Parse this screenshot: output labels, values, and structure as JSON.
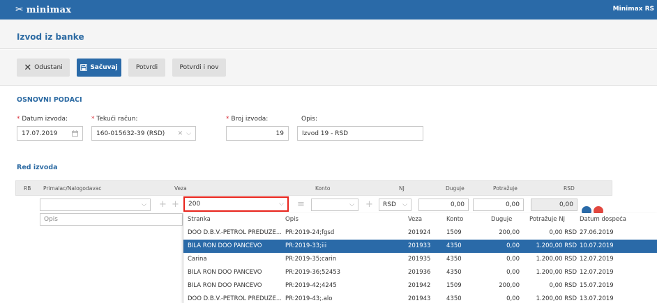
{
  "topbar": {
    "logo_text": "minimax",
    "logo_icon": "percent-scissors-icon",
    "company": "Minimax RS"
  },
  "page": {
    "title": "Izvod iz banke"
  },
  "toolbar": {
    "cancel_icon": "close-icon",
    "cancel_label": "Odustani",
    "save_icon": "floppy-disk-icon",
    "save_label": "Sačuvaj",
    "confirm_label": "Potvrdi",
    "confirm_new_label": "Potvrdi i nov"
  },
  "basic": {
    "section_title": "OSNOVNI PODACI",
    "required_mark": "*",
    "date_label": "Datum izvoda:",
    "date_value": "17.07.2019",
    "account_label": "Tekući račun:",
    "account_value": "160-015632-39 (RSD)",
    "number_label": "Broj izvoda:",
    "number_value": "19",
    "desc_label": "Opis:",
    "desc_value": "Izvod 19 - RSD"
  },
  "lines": {
    "section_title": "Red izvoda",
    "columns": {
      "rb": "RB",
      "partner": "Primalac/Nalogodavac",
      "link": "Veza",
      "account": "Konto",
      "nj": "NJ",
      "debit": "Duguje",
      "credit": "Potražuje",
      "rsd": "RSD"
    },
    "row": {
      "link_value": "200",
      "currency": "RSD",
      "debit": "0,00",
      "credit": "0,00",
      "rsd": "0,00",
      "desc_placeholder": "Opis"
    }
  },
  "dropdown": {
    "headers": [
      "Stranka",
      "Opis",
      "Veza",
      "Konto",
      "Duguje",
      "Potražuje NJ",
      "Datum dospeća"
    ],
    "rows": [
      [
        "DOO D.B.V.-PETROL PREDUZE...",
        "PR:2019-24;fgsd",
        "201924",
        "1509",
        "200,00",
        "0,00 RSD",
        "27.06.2019"
      ],
      [
        "BILA RON DOO PANČEVO",
        "PR:2019-33;iii",
        "201933",
        "4350",
        "0,00",
        "1.200,00 RSD",
        "10.07.2019"
      ],
      [
        "Carina",
        "PR:2019-35;carin",
        "201935",
        "4350",
        "0,00",
        "1.200,00 RSD",
        "12.07.2019"
      ],
      [
        "BILA RON DOO PANČEVO",
        "PR:2019-36;52453",
        "201936",
        "4350",
        "0,00",
        "1.200,00 RSD",
        "12.07.2019"
      ],
      [
        "BILA RON DOO PANČEVO",
        "PR:2019-42;4245",
        "201942",
        "1509",
        "200,00",
        "0,00 RSD",
        "15.07.2019"
      ],
      [
        "DOO D.B.V.-PETROL PREDUZE...",
        "PR:2019-43;.alo",
        "201943",
        "4350",
        "0,00",
        "1.200,00 RSD",
        "13.07.2019"
      ]
    ],
    "selected_index": 1
  },
  "colors": {
    "brand": "#2a6aa8",
    "heading": "#2d6ba3",
    "required": "#d9303a",
    "highlight": "#e8241c"
  }
}
